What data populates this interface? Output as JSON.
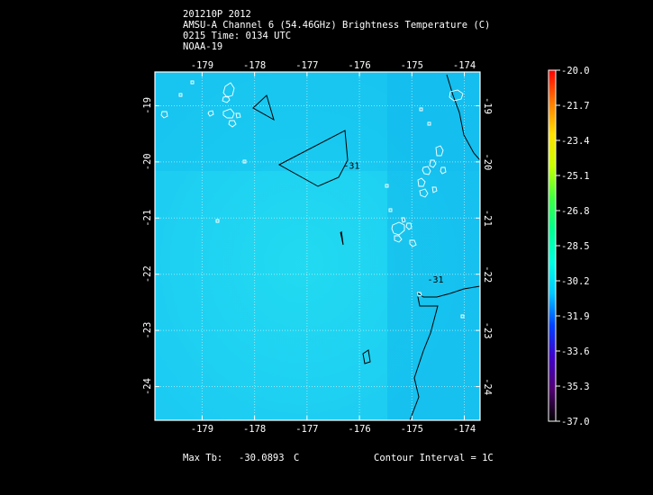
{
  "header": {
    "line1": "201210P 2012",
    "line2": "AMSU-A Channel 6 (54.46GHz) Brightness Temperature (C)",
    "line3": "0215 Time: 0134 UTC",
    "line4": "NOAA-19"
  },
  "map": {
    "lon_range": [
      -179.9,
      -173.7
    ],
    "lat_range": [
      -24.6,
      -18.4
    ],
    "lon_ticks": [
      -179,
      -178,
      -177,
      -176,
      -175,
      -174
    ],
    "lat_ticks": [
      -19,
      -20,
      -21,
      -22,
      -23,
      -24
    ],
    "lon_tick_labels": [
      "-179",
      "-178",
      "-177",
      "-176",
      "-175",
      "-174"
    ],
    "lat_tick_labels": [
      "-19",
      "-20",
      "-21",
      "-22",
      "-23",
      "-24"
    ],
    "gridlines": true,
    "field_color": "#1ccaf2",
    "contour_color": "#000000",
    "coast_color": "#ffffff",
    "contour_labels": [
      {
        "text": "-31",
        "lon": -176.15,
        "lat": -20.12
      },
      {
        "text": "-31",
        "lon": -174.55,
        "lat": -22.15
      }
    ]
  },
  "colorbar": {
    "min": -37.0,
    "max": -20.0,
    "labels": [
      "-20.0",
      "-21.7",
      "-23.4",
      "-25.1",
      "-26.8",
      "-28.5",
      "-30.2",
      "-31.9",
      "-33.6",
      "-35.3",
      "-37.0"
    ],
    "colors": [
      "#ff0000",
      "#ff7a00",
      "#ffe000",
      "#c8ff00",
      "#40ff40",
      "#00ff90",
      "#00ffe0",
      "#00c8ff",
      "#0040ff",
      "#4000c8",
      "#500070",
      "#000000"
    ]
  },
  "footer": {
    "max_label": "Max Tb:",
    "max_value": "-30.0893",
    "max_unit": "C",
    "contour_interval": "Contour Interval = 1C"
  }
}
